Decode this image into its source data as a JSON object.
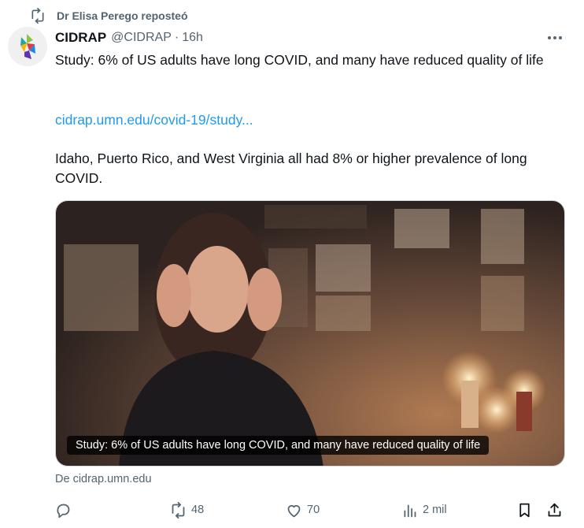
{
  "repost": {
    "label": "Dr Elisa Perego reposteó"
  },
  "tweet": {
    "author_name": "CIDRAP",
    "author_handle": "@CIDRAP",
    "separator": "·",
    "time": "16h",
    "text_line_1": "Study: 6% of US adults have long COVID, and many have reduced quality of life",
    "link": "cidrap.umn.edu/covid-19/study...",
    "text_line_2": "Idaho, Puerto Rico, and West Virginia all had 8% or higher prevalence of long COVID.",
    "card_caption": "Study: 6% of US adults have long COVID, and many have reduced quality of life",
    "card_source": "De cidrap.umn.edu"
  },
  "actions": {
    "reply_count": "",
    "repost_count": "48",
    "like_count": "70",
    "views_count": "2 mil"
  },
  "icons": [
    "repost-icon",
    "more-icon",
    "reply-icon",
    "like-icon",
    "views-icon",
    "bookmark-icon",
    "share-icon"
  ],
  "colors": {
    "link": "#1d9bf0",
    "muted": "#536471",
    "text": "#0f1419"
  }
}
